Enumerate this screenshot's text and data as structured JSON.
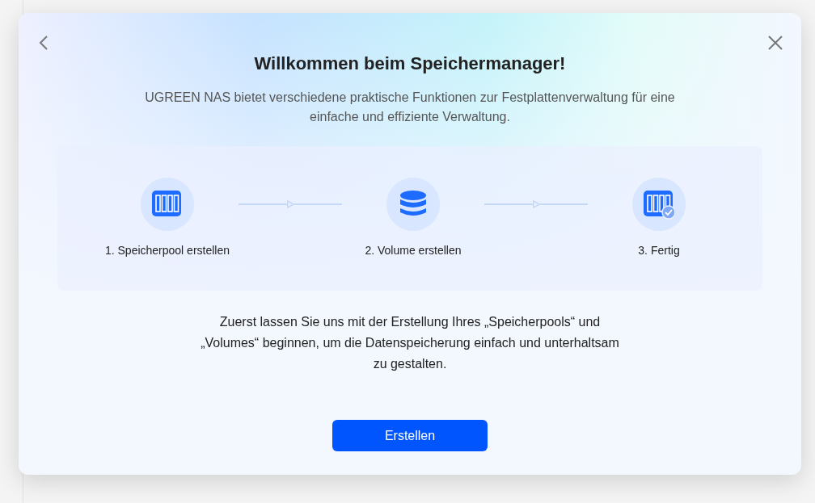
{
  "dialog": {
    "title": "Willkommen beim Speichermanager!",
    "subtitle": "UGREEN NAS bietet verschiedene praktische Funktionen zur Festplattenverwaltung für eine einfache und effiziente Verwaltung.",
    "steps": [
      {
        "kind": "pool",
        "label": "1. Speicherpool erstellen"
      },
      {
        "kind": "volume",
        "label": "2. Volume erstellen"
      },
      {
        "kind": "done",
        "label": "3. Fertig"
      }
    ],
    "description": "Zuerst lassen Sie uns mit der Erstellung Ihres „Speicherpools“ und „Volumes“ beginnen, um die Datenspeicherung einfach und unterhaltsam zu gestalten.",
    "button": "Erstellen"
  }
}
